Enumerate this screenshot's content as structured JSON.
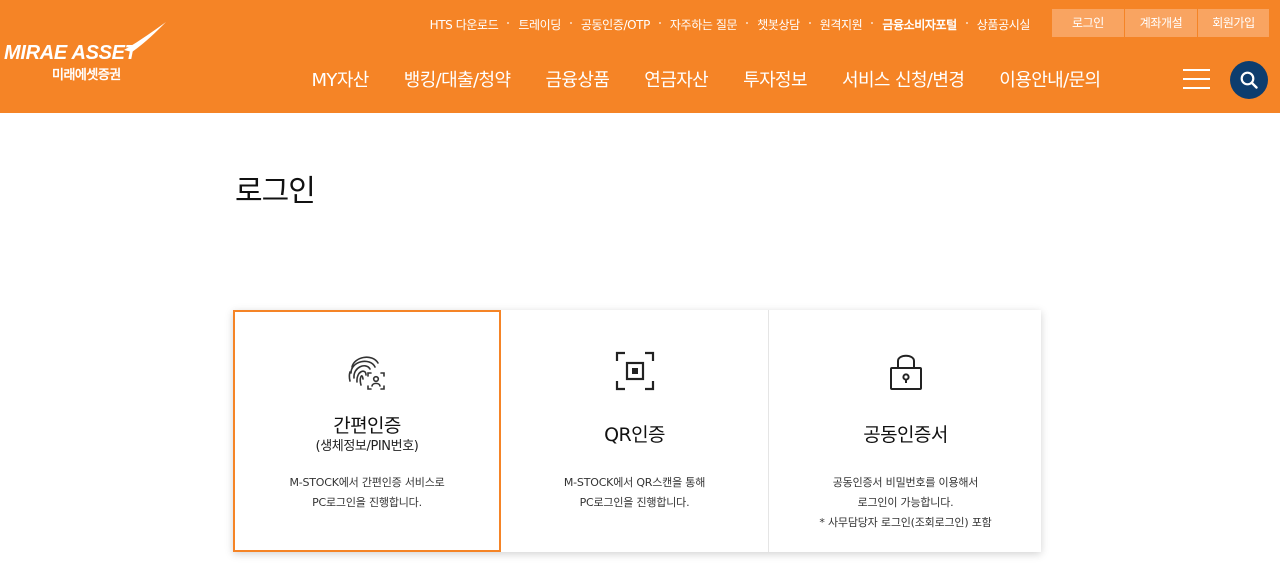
{
  "brand": {
    "logo_en": "MIRAE ASSET",
    "logo_ko": "미래에셋증권",
    "color_primary": "#f58426",
    "color_search": "#0d3d6e"
  },
  "util_nav": [
    {
      "label": "HTS 다운로드"
    },
    {
      "label": "트레이딩"
    },
    {
      "label": "공동인증/OTP"
    },
    {
      "label": "자주하는 질문"
    },
    {
      "label": "챗봇상담"
    },
    {
      "label": "원격지원"
    },
    {
      "label": "금융소비자포털"
    },
    {
      "label": "상품공시실"
    }
  ],
  "account_buttons": {
    "login": "로그인",
    "open_account": "계좌개설",
    "signup": "회원가입"
  },
  "main_nav": [
    {
      "label": "MY자산"
    },
    {
      "label": "뱅킹/대출/청약"
    },
    {
      "label": "금융상품"
    },
    {
      "label": "연금자산"
    },
    {
      "label": "투자정보"
    },
    {
      "label": "서비스 신청/변경"
    },
    {
      "label": "이용안내/문의"
    }
  ],
  "icons": {
    "menu": "hamburger-menu-icon",
    "search": "search-icon",
    "fingerprint": "fingerprint-icon",
    "qr": "qr-scan-icon",
    "lock": "lock-icon"
  },
  "page": {
    "title": "로그인"
  },
  "login_methods": [
    {
      "title": "간편인증",
      "subtitle": "(생체정보/PIN번호)",
      "desc": [
        "M-STOCK에서 간편인증 서비스로",
        "PC로그인을 진행합니다."
      ],
      "selected": true
    },
    {
      "title": "QR인증",
      "desc": [
        "M-STOCK에서 QR스캔을 통해",
        "PC로그인을 진행합니다."
      ]
    },
    {
      "title": "공동인증서",
      "desc": [
        "공동인증서 비밀번호를 이용해서",
        "로그인이 가능합니다.",
        "* 사무담당자 로그인(조회로그인) 포함"
      ]
    }
  ]
}
